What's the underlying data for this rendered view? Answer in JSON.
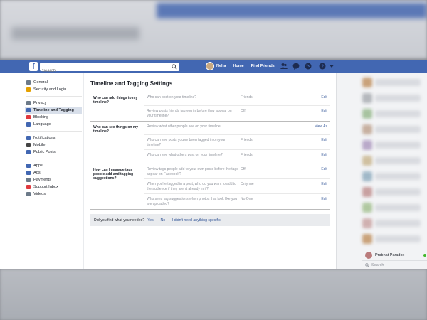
{
  "topbar": {
    "logo": "f",
    "search_placeholder": "Search",
    "user_name": "Neha",
    "home": "Home",
    "find_friends": "Find Friends"
  },
  "sidebar": {
    "groups": [
      [
        {
          "label": "General",
          "icon": "gear-icon",
          "color": "#6c7a89"
        },
        {
          "label": "Security and Login",
          "icon": "shield-icon",
          "color": "#e5a100"
        }
      ],
      [
        {
          "label": "Privacy",
          "icon": "lock-icon",
          "color": "#6c7a89"
        },
        {
          "label": "Timeline and Tagging",
          "icon": "timeline-icon",
          "color": "#4267b2",
          "active": true
        },
        {
          "label": "Blocking",
          "icon": "block-icon",
          "color": "#e0393e"
        },
        {
          "label": "Language",
          "icon": "language-icon",
          "color": "#4267b2"
        }
      ],
      [
        {
          "label": "Notifications",
          "icon": "globe-icon",
          "color": "#4267b2"
        },
        {
          "label": "Mobile",
          "icon": "mobile-icon",
          "color": "#444"
        },
        {
          "label": "Public Posts",
          "icon": "public-icon",
          "color": "#4267b2"
        }
      ],
      [
        {
          "label": "Apps",
          "icon": "apps-icon",
          "color": "#4267b2"
        },
        {
          "label": "Ads",
          "icon": "ads-icon",
          "color": "#4267b2"
        },
        {
          "label": "Payments",
          "icon": "payments-icon",
          "color": "#6c7a89"
        },
        {
          "label": "Support Inbox",
          "icon": "support-icon",
          "color": "#e0393e"
        },
        {
          "label": "Videos",
          "icon": "video-icon",
          "color": "#6c7a89"
        }
      ]
    ]
  },
  "content": {
    "title": "Timeline and Tagging Settings",
    "sections": [
      {
        "question": "Who can add things to my timeline?",
        "rows": [
          {
            "q": "Who can post on your timeline?",
            "v": "Friends",
            "e": "Edit"
          },
          {
            "q": "Review posts friends tag you in before they appear on your timeline?",
            "v": "Off",
            "e": "Edit"
          }
        ]
      },
      {
        "question": "Who can see things on my timeline?",
        "rows": [
          {
            "q": "Review what other people see on your timeline",
            "v": "",
            "e": "View As"
          },
          {
            "q": "Who can see posts you've been tagged in on your timeline?",
            "v": "Friends",
            "e": "Edit"
          },
          {
            "q": "Who can see what others post on your timeline?",
            "v": "Friends",
            "e": "Edit"
          }
        ]
      },
      {
        "question": "How can I manage tags people add and tagging suggestions?",
        "rows": [
          {
            "q": "Review tags people add to your own posts before the tags appear on Facebook?",
            "v": "Off",
            "e": "Edit"
          },
          {
            "q": "When you're tagged in a post, who do you want to add to the audience if they aren't already in it?",
            "v": "Only me",
            "e": "Edit"
          },
          {
            "q": "Who sees tag suggestions when photos that look like you are uploaded?",
            "v": "No One",
            "e": "Edit"
          }
        ]
      }
    ],
    "feedback": {
      "question": "Did you find what you needed?",
      "yes": "Yes",
      "no": "No",
      "dont_need": "I didn't need anything specific"
    }
  },
  "chat": {
    "contact_name": "Prabhat Paradox",
    "search_placeholder": "Search"
  }
}
